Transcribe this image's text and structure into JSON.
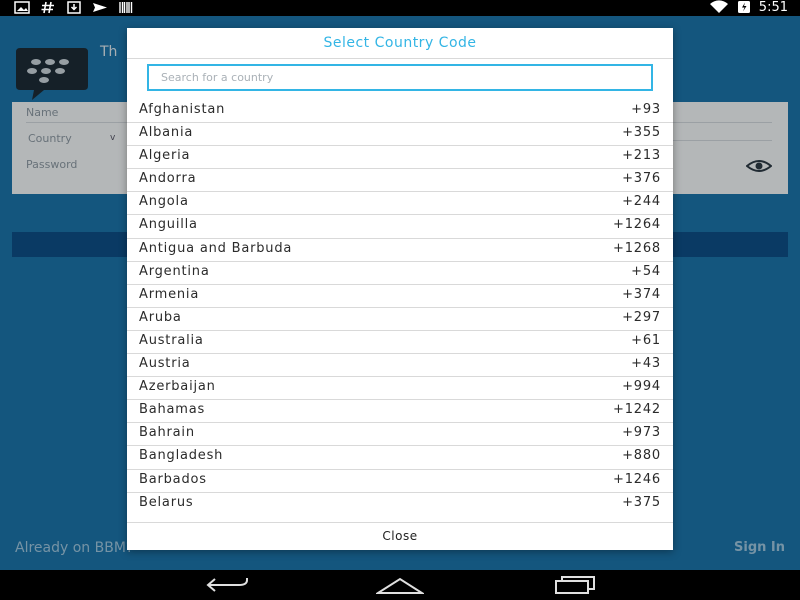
{
  "status_bar": {
    "time": "5:51",
    "left_icons": [
      "image-icon",
      "hash-icon",
      "download-icon",
      "send-icon",
      "barcode-icon"
    ],
    "right_icons": [
      "wifi-icon",
      "battery-icon"
    ]
  },
  "background_app": {
    "title_partial": "Th",
    "fields": {
      "name_label": "Name",
      "country_label": "Country",
      "password_label": "Password"
    },
    "bottom_left_text": "Already on BBM?",
    "sign_in_label": "Sign In",
    "colors": {
      "background": "#1b73a8",
      "bar": "#0e4e86"
    }
  },
  "dialog": {
    "title": "Select Country Code",
    "search_placeholder": "Search for a country",
    "search_value": "",
    "countries": [
      {
        "name": "Afghanistan",
        "code": "+93"
      },
      {
        "name": "Albania",
        "code": "+355"
      },
      {
        "name": "Algeria",
        "code": "+213"
      },
      {
        "name": "Andorra",
        "code": "+376"
      },
      {
        "name": "Angola",
        "code": "+244"
      },
      {
        "name": "Anguilla",
        "code": "+1264"
      },
      {
        "name": "Antigua and Barbuda",
        "code": "+1268"
      },
      {
        "name": "Argentina",
        "code": "+54"
      },
      {
        "name": "Armenia",
        "code": "+374"
      },
      {
        "name": "Aruba",
        "code": "+297"
      },
      {
        "name": "Australia",
        "code": "+61"
      },
      {
        "name": "Austria",
        "code": "+43"
      },
      {
        "name": "Azerbaijan",
        "code": "+994"
      },
      {
        "name": "Bahamas",
        "code": "+1242"
      },
      {
        "name": "Bahrain",
        "code": "+973"
      },
      {
        "name": "Bangladesh",
        "code": "+880"
      },
      {
        "name": "Barbados",
        "code": "+1246"
      },
      {
        "name": "Belarus",
        "code": "+375"
      }
    ],
    "close_label": "Close",
    "accent_color": "#33b5e5"
  },
  "nav_bar": {
    "icons": [
      "back-icon",
      "home-icon",
      "recents-icon"
    ]
  }
}
